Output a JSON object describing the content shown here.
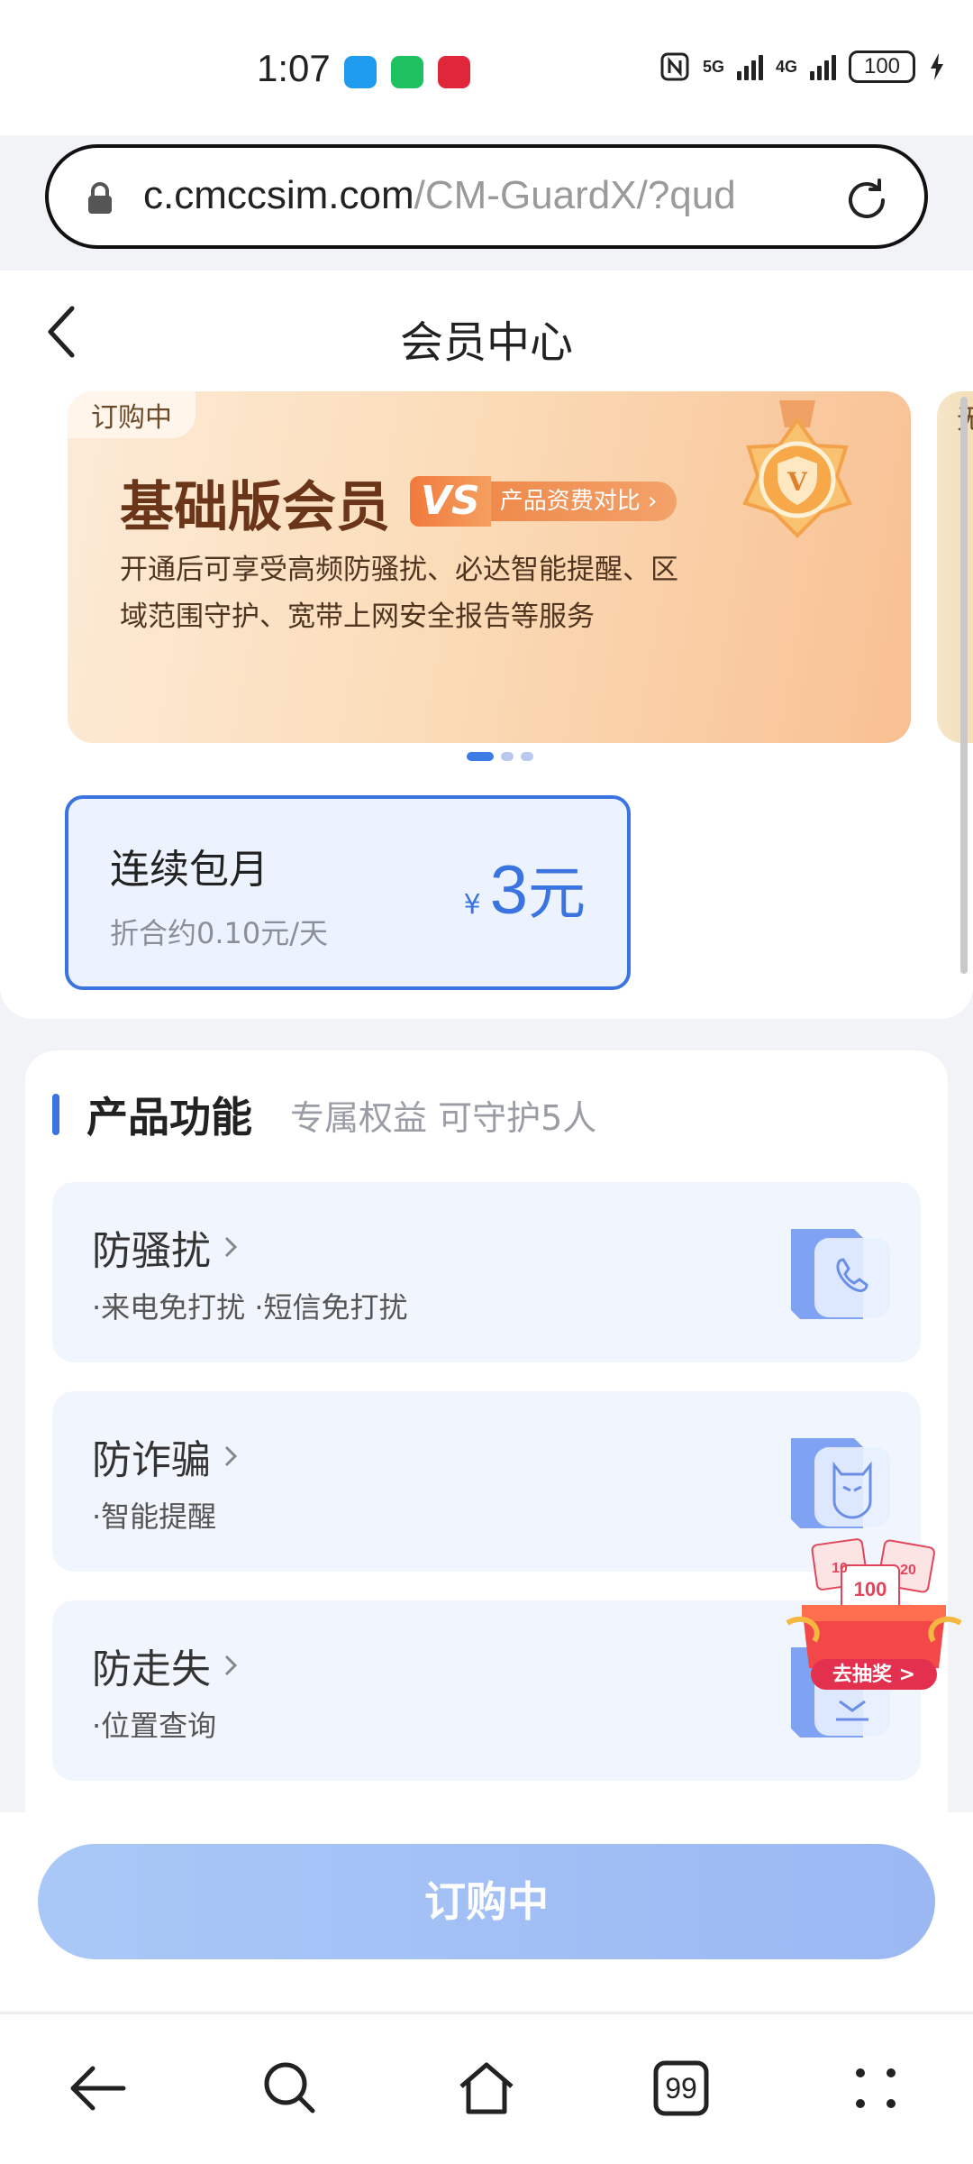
{
  "status_bar": {
    "time": "1:07",
    "signal_1": "5G",
    "signal_2": "4G",
    "battery": "100"
  },
  "browser": {
    "url_host": "c.cmccsim.com",
    "url_path": "/CM-GuardX/?qud"
  },
  "header": {
    "title": "会员中心"
  },
  "banner": {
    "tag": "订购中",
    "title": "基础版会员",
    "vs_mark": "VS",
    "compare_label": "产品资费对比",
    "description": "开通后可享受高频防骚扰、必达智能提醒、区域范围守护、宽带上网安全报告等服务",
    "medal_letter": "V",
    "peek_text": "无"
  },
  "plan": {
    "name": "连续包月",
    "per_day": "折合约0.10元/天",
    "currency": "¥",
    "amount": "3",
    "unit": "元"
  },
  "features": {
    "title": "产品功能",
    "subtitle": "专属权益 可守护5人",
    "items": [
      {
        "name": "防骚扰",
        "desc": "·来电免打扰 ·短信免打扰",
        "icon": "phone-icon"
      },
      {
        "name": "防诈骗",
        "desc": "·智能提醒",
        "icon": "mask-icon"
      },
      {
        "name": "防走失",
        "desc": "·位置查询",
        "icon": "location-icon"
      }
    ]
  },
  "lottery": {
    "label": "去抽奖 >",
    "coupon_1": "10",
    "coupon_2": "100",
    "coupon_3": "20"
  },
  "action": {
    "subscribe_label": "订购中"
  },
  "browser_nav": {
    "tabs_count": "99"
  },
  "colors": {
    "accent": "#3b74e0",
    "banner_title": "#6a3518",
    "button": "#a9c8f7"
  }
}
